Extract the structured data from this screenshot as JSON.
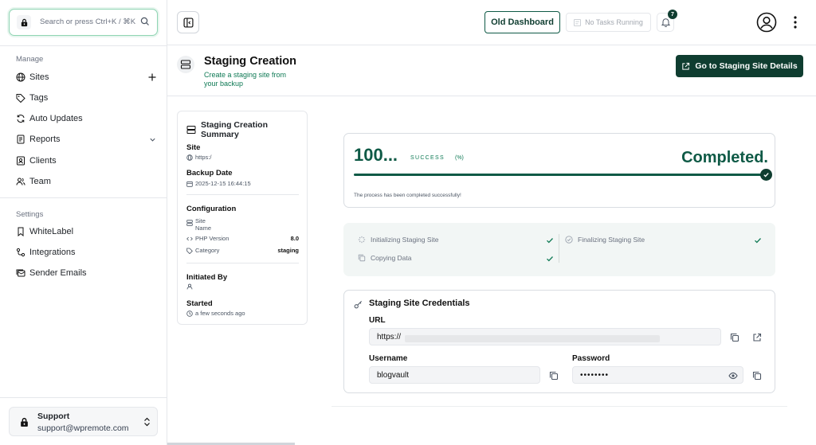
{
  "search": {
    "placeholder": "Search or press Ctrl+K / ⌘K"
  },
  "sidebar": {
    "manage_title": "Manage",
    "manage_items": [
      {
        "label": "Sites",
        "icon": "globe-icon"
      },
      {
        "label": "Tags",
        "icon": "tag-icon"
      },
      {
        "label": "Auto Updates",
        "icon": "refresh-icon"
      },
      {
        "label": "Reports",
        "icon": "report-icon"
      },
      {
        "label": "Clients",
        "icon": "contact-icon"
      },
      {
        "label": "Team",
        "icon": "users-icon"
      }
    ],
    "settings_title": "Settings",
    "settings_items": [
      {
        "label": "WhiteLabel",
        "icon": "bookmark-icon"
      },
      {
        "label": "Integrations",
        "icon": "integration-icon"
      },
      {
        "label": "Sender Emails",
        "icon": "mail-stack-icon"
      }
    ],
    "support": {
      "name": "Support",
      "email": "support@wpremote.com"
    }
  },
  "topbar": {
    "old_dashboard": "Old Dashboard",
    "no_tasks": "No Tasks Running",
    "notification_count": "7"
  },
  "header": {
    "title": "Staging Creation",
    "subtitle": "Create a staging site from your backup",
    "goto_button": "Go to Staging Site Details"
  },
  "summary": {
    "title": "Staging Creation Summary",
    "site_label": "Site",
    "site_value": "https:/",
    "backup_date_label": "Backup Date",
    "backup_date_value": "2025-12-15 16:44:15",
    "configuration_label": "Configuration",
    "site_name_label": "Site Name",
    "php_label": "PHP Version",
    "php_value": "8.0",
    "category_label": "Category",
    "category_value": "staging",
    "initiated_by_label": "Initiated By",
    "initiated_by_value": "",
    "started_label": "Started",
    "started_value": "a few seconds ago"
  },
  "progress": {
    "percent_text": "100...",
    "percent_value": 100,
    "status": "SUCCESS",
    "unit": "(%)",
    "state": "Completed.",
    "message": "The process has been completed successfully!"
  },
  "steps": {
    "initializing": "Initializing Staging Site",
    "copying": "Copying Data",
    "finalizing": "Finalizing Staging Site"
  },
  "credentials": {
    "title": "Staging Site Credentials",
    "url_label": "URL",
    "url_value": "https://",
    "username_label": "Username",
    "username_value": "blogvault",
    "password_label": "Password",
    "password_value": "••••••••"
  },
  "colors": {
    "brand": "#0f3d30",
    "accent": "#0f7a55"
  }
}
